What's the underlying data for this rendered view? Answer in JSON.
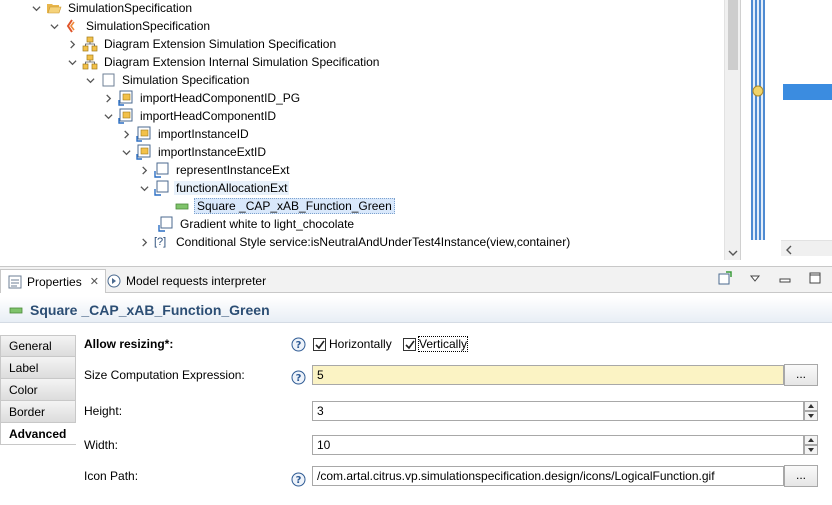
{
  "tree": {
    "rows": [
      {
        "label": "SimulationSpecification",
        "twisty": "expanded",
        "icon": "folder-open-icon"
      },
      {
        "label": "SimulationSpecification",
        "twisty": "expanded",
        "icon": "sirius-viewpoint-icon"
      },
      {
        "label": "Diagram Extension Simulation Specification",
        "twisty": "collapsed",
        "icon": "diagram-extension-icon"
      },
      {
        "label": "Diagram Extension Internal Simulation Specification",
        "twisty": "expanded",
        "icon": "diagram-extension-icon"
      },
      {
        "label": "Simulation Specification",
        "twisty": "expanded",
        "icon": "layer-icon"
      },
      {
        "label": "importHeadComponentID_PG",
        "twisty": "collapsed",
        "icon": "container-mapping-icon"
      },
      {
        "label": "importHeadComponentID",
        "twisty": "expanded",
        "icon": "container-mapping-icon"
      },
      {
        "label": "importInstanceID",
        "twisty": "collapsed",
        "icon": "container-mapping-icon"
      },
      {
        "label": "importInstanceExtID",
        "twisty": "expanded",
        "icon": "container-mapping-icon"
      },
      {
        "label": "representInstanceExt",
        "twisty": "collapsed",
        "icon": "node-mapping-icon"
      },
      {
        "label": "functionAllocationExt",
        "twisty": "expanded",
        "icon": "node-mapping-icon"
      },
      {
        "label": "Square _CAP_xAB_Function_Green",
        "twisty": "none",
        "icon": "square-style-icon"
      },
      {
        "label": "Gradient white to light_chocolate",
        "twisty": "none",
        "icon": "gradient-style-icon"
      },
      {
        "label": "Conditional Style service:isNeutralAndUnderTest4Instance(view,container)",
        "twisty": "collapsed",
        "icon": "conditional-style-icon"
      }
    ]
  },
  "properties_view": {
    "tabs": [
      {
        "label": "Properties",
        "closable": "✕"
      },
      {
        "label": "Model requests interpreter"
      }
    ],
    "title": "Square _CAP_xAB_Function_Green",
    "side_tabs": [
      "General",
      "Label",
      "Color",
      "Border",
      "Advanced"
    ],
    "allow_resizing": {
      "label": "Allow resizing*:",
      "horizontally": {
        "label": "Horizontally",
        "checked": true
      },
      "vertically": {
        "label": "Vertically",
        "checked": true
      }
    },
    "size_expression": {
      "label": "Size Computation Expression:",
      "value": "5",
      "button": "..."
    },
    "height": {
      "label": "Height:",
      "value": "3"
    },
    "width": {
      "label": "Width:",
      "value": "10"
    },
    "icon_path": {
      "label": "Icon Path:",
      "value": "/com.artal.citrus.vp.simulationspecification.design/icons/LogicalFunction.gif",
      "button": "..."
    }
  },
  "colors": {
    "title_text": "#2c4e74",
    "selection": "#d9e8fb",
    "expression_field": "#fbf3c4",
    "overview_bar": "#3b8ce0"
  }
}
